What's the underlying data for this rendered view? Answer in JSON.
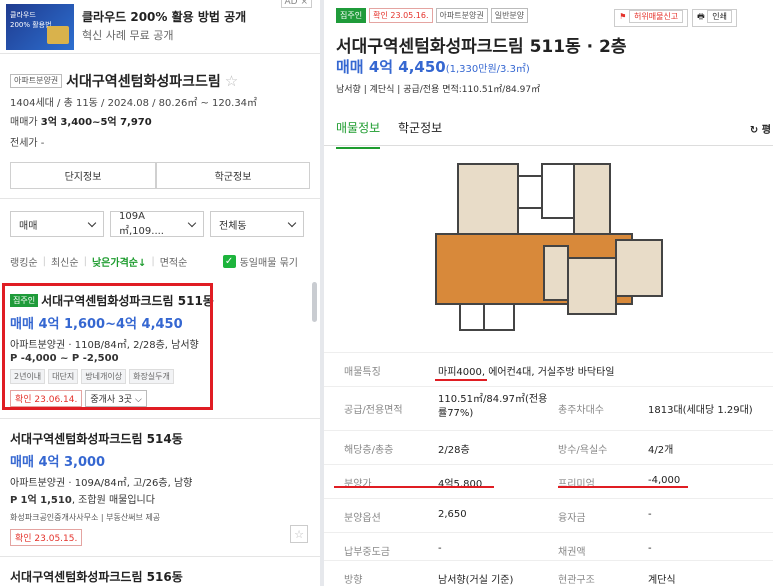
{
  "ad": {
    "title": "클라우드 200% 활용 방법 공개",
    "subtitle": "혁신 사례 무료 공개",
    "image_text": "클라우드\n200% 활용법",
    "tag": "AD ×"
  },
  "complex": {
    "tag": "아파트분양권",
    "name": "서대구역센텀화성파크드림",
    "info": "1404세대 / 총 11동 / 2024.08 / 80.26㎡ ~ 120.34㎡",
    "sale_label": "매매가",
    "sale_value": "3억 3,400~5억 7,970",
    "rent": "전세가 -"
  },
  "tabs": {
    "complex_info": "단지정보",
    "school_info": "학군정보"
  },
  "filters": {
    "trade": "매매",
    "area": "109A㎡,109....",
    "dong": "전체동"
  },
  "sort": {
    "items": [
      "랭킹순",
      "최신순",
      "낮은가격순↓",
      "면적순"
    ],
    "active": 2,
    "same_listing": "동일매물 묶기"
  },
  "listings": [
    {
      "badge": "집주인",
      "name": "서대구역센텀화성파크드림 511동",
      "price": "매매 4억 1,600~4억 4,450",
      "spec": "아파트분양권 · 110B/84㎡, 2/28층, 남서향",
      "premium": "P -4,000 ~ P -2,500",
      "chips": [
        "2년이내",
        "대단지",
        "방네개이상",
        "화장실두개"
      ],
      "confirm": "확인 23.06.14.",
      "agents": "중개사 3곳"
    },
    {
      "name": "서대구역센텀화성파크드림 514동",
      "price": "매매 4억 3,000",
      "spec": "아파트분양권 · 109A/84㎡, 고/26층, 남향",
      "premium_label": "P",
      "premium_value": "1억 1,510",
      "premium_tail": ", 조합원 매물입니다",
      "agent_info": "화성파크공인중개사사무소 | 부동산써브 제공",
      "confirm": "확인 23.05.15."
    },
    {
      "name": "서대구역센텀화성파크드림 516동"
    }
  ],
  "detail": {
    "tags": [
      "집주인",
      "확인 23.05.16.",
      "아파트분양권",
      "일반분양"
    ],
    "report": "허위매물신고",
    "print": "인쇄",
    "title": "서대구역센텀화성파크드림 511동 · 2층",
    "price": "매매 4억 4,450",
    "price_sub": "(1,330만원/3.3㎡)",
    "desc": "남서향 | 계단식 | 공급/전용 면적:110.51㎡/84.97㎡",
    "tab_listing": "매물정보",
    "tab_school": "학군정보",
    "refresh": "평",
    "rows": [
      {
        "l1": "매물특징",
        "v1": "마피4000, 에어컨4대, 거실주방 바닥타일"
      },
      {
        "l1": "공급/전용면적",
        "v1": "110.51㎡/84.97㎡(전용률77%)",
        "l2": "총주차대수",
        "v2": "1813대(세대당 1.29대)"
      },
      {
        "l1": "해당층/총층",
        "v1": "2/28층",
        "l2": "방수/욕실수",
        "v2": "4/2개"
      },
      {
        "l1": "분양가",
        "v1": "4억5,800",
        "l2": "프리미엄",
        "v2": "-4,000"
      },
      {
        "l1": "분양옵션",
        "v1": "2,650",
        "l2": "융자금",
        "v2": "-"
      },
      {
        "l1": "납부중도금",
        "v1": "-",
        "l2": "채권액",
        "v2": "-"
      },
      {
        "l1": "방향",
        "v1": "남서향(거실 기준)",
        "l2": "현관구조",
        "v2": "계단식"
      }
    ]
  }
}
